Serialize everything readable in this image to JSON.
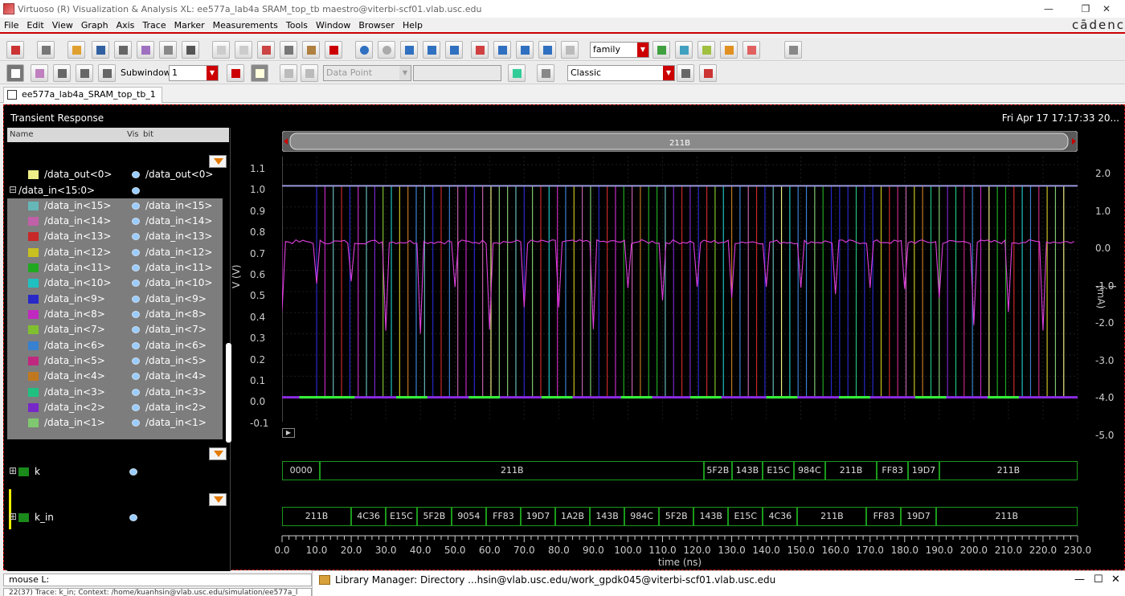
{
  "window": {
    "title": "Virtuoso (R) Visualization & Analysis XL: ee577a_lab4a SRAM_top_tb maestro@viterbi-scf01.vlab.usc.edu",
    "minimize": "—",
    "restore": "❐",
    "close": "✕"
  },
  "menu": {
    "items": [
      "File",
      "Edit",
      "View",
      "Graph",
      "Axis",
      "Trace",
      "Marker",
      "Measurements",
      "Tools",
      "Window",
      "Browser",
      "Help"
    ],
    "brand": "cādenc"
  },
  "toolbar2": {
    "subwindow_label": "Subwindow:",
    "subwindow_value": "1",
    "datapoint_value": "Data Point",
    "style_value": "Classic"
  },
  "toolbar1": {
    "family_value": "family"
  },
  "tab": {
    "label": "ee577a_lab4a_SRAM_top_tb_1"
  },
  "panel": {
    "title": "Transient Response",
    "datetime": "Fri Apr 17 17:17:33 20..."
  },
  "tree": {
    "headers": {
      "name": "Name",
      "vis": "Vis",
      "bit": "bit"
    },
    "rows": [
      {
        "label": "/data_out<0>",
        "bit": "/data_out<0>",
        "color": "#eeee88"
      },
      {
        "label": "/data_in<15:0>",
        "bit": "",
        "color": ""
      },
      {
        "label": "/data_in<15>",
        "bit": "/data_in<15>",
        "color": "#66b8b8"
      },
      {
        "label": "/data_in<14>",
        "bit": "/data_in<14>",
        "color": "#c060a8"
      },
      {
        "label": "/data_in<13>",
        "bit": "/data_in<13>",
        "color": "#c82828"
      },
      {
        "label": "/data_in<12>",
        "bit": "/data_in<12>",
        "color": "#c8c020"
      },
      {
        "label": "/data_in<11>",
        "bit": "/data_in<11>",
        "color": "#20a820"
      },
      {
        "label": "/data_in<10>",
        "bit": "/data_in<10>",
        "color": "#20c0c0"
      },
      {
        "label": "/data_in<9>",
        "bit": "/data_in<9>",
        "color": "#2828c8"
      },
      {
        "label": "/data_in<8>",
        "bit": "/data_in<8>",
        "color": "#c028c0"
      },
      {
        "label": "/data_in<7>",
        "bit": "/data_in<7>",
        "color": "#80c030"
      },
      {
        "label": "/data_in<6>",
        "bit": "/data_in<6>",
        "color": "#3880d0"
      },
      {
        "label": "/data_in<5>",
        "bit": "/data_in<5>",
        "color": "#c02880"
      },
      {
        "label": "/data_in<4>",
        "bit": "/data_in<4>",
        "color": "#c07820"
      },
      {
        "label": "/data_in<3>",
        "bit": "/data_in<3>",
        "color": "#20c080"
      },
      {
        "label": "/data_in<2>",
        "bit": "/data_in<2>",
        "color": "#7828c8"
      },
      {
        "label": "/data_in<1>",
        "bit": "/data_in<1>",
        "color": "#80c870"
      }
    ],
    "bus_k": {
      "label": "k",
      "color": "#1a8a1a"
    },
    "bus_kin": {
      "label": "k_in",
      "color": "#1a8a1a"
    }
  },
  "scrubber": {
    "label": "211B"
  },
  "axes": {
    "y_left_label": "V (V)",
    "y_left_ticks": [
      "1.1",
      "1.0",
      "0.9",
      "0.8",
      "0.7",
      "0.6",
      "0.5",
      "0.4",
      "0.3",
      "0.2",
      "0.1",
      "0.0",
      "-0.1"
    ],
    "y_right_label": "I (mA)",
    "y_right_ticks": [
      "2.0",
      "1.0",
      "0.0",
      "-1.0",
      "-2.0",
      "-3.0",
      "-4.0",
      "-5.0"
    ],
    "x_label": "time (ns)",
    "x_ticks": [
      "0.0",
      "10.0",
      "20.0",
      "30.0",
      "40.0",
      "50.0",
      "60.0",
      "70.0",
      "80.0",
      "90.0",
      "100.0",
      "110.0",
      "120.0",
      "130.0",
      "140.0",
      "150.0",
      "160.0",
      "170.0",
      "180.0",
      "190.0",
      "200.0",
      "210.0",
      "220.0",
      "230.0"
    ]
  },
  "bus_k_values": [
    {
      "t0": 0,
      "t1": 11,
      "v": "0000"
    },
    {
      "t0": 11,
      "t1": 122,
      "v": "211B"
    },
    {
      "t0": 122,
      "t1": 130,
      "v": "5F2B"
    },
    {
      "t0": 130,
      "t1": 139,
      "v": "143B"
    },
    {
      "t0": 139,
      "t1": 148,
      "v": "E15C"
    },
    {
      "t0": 148,
      "t1": 157,
      "v": "984C"
    },
    {
      "t0": 157,
      "t1": 172,
      "v": "211B"
    },
    {
      "t0": 172,
      "t1": 181,
      "v": "FF83"
    },
    {
      "t0": 181,
      "t1": 190,
      "v": "19D7"
    },
    {
      "t0": 190,
      "t1": 230,
      "v": "211B"
    }
  ],
  "bus_kin_values": [
    {
      "t0": 0,
      "t1": 20,
      "v": "211B"
    },
    {
      "t0": 20,
      "t1": 30,
      "v": "4C36"
    },
    {
      "t0": 30,
      "t1": 39,
      "v": "E15C"
    },
    {
      "t0": 39,
      "t1": 49,
      "v": "5F2B"
    },
    {
      "t0": 49,
      "t1": 59,
      "v": "9054"
    },
    {
      "t0": 59,
      "t1": 69,
      "v": "FF83"
    },
    {
      "t0": 69,
      "t1": 79,
      "v": "19D7"
    },
    {
      "t0": 79,
      "t1": 89,
      "v": "1A2B"
    },
    {
      "t0": 89,
      "t1": 99,
      "v": "143B"
    },
    {
      "t0": 99,
      "t1": 109,
      "v": "984C"
    },
    {
      "t0": 109,
      "t1": 119,
      "v": "5F2B"
    },
    {
      "t0": 119,
      "t1": 129,
      "v": "143B"
    },
    {
      "t0": 129,
      "t1": 139,
      "v": "E15C"
    },
    {
      "t0": 139,
      "t1": 149,
      "v": "4C36"
    },
    {
      "t0": 149,
      "t1": 169,
      "v": "211B"
    },
    {
      "t0": 169,
      "t1": 179,
      "v": "FF83"
    },
    {
      "t0": 179,
      "t1": 189,
      "v": "19D7"
    },
    {
      "t0": 189,
      "t1": 230,
      "v": "211B"
    }
  ],
  "status": {
    "mouse": "mouse L:",
    "trace": "22(37)    Trace: k_in; Context: /home/kuanhsin@vlab.usc.edu/simulation/ee577a_l"
  },
  "library_manager": {
    "title": "Library Manager: Directory ...hsin@vlab.usc.edu/work_gpdk045@viterbi-scf01.vlab.usc.edu"
  }
}
